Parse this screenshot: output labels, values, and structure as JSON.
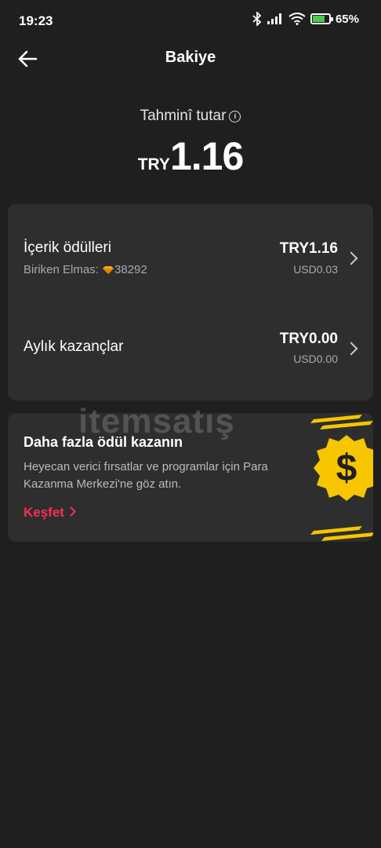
{
  "status": {
    "time": "19:23",
    "battery": "65%"
  },
  "header": {
    "title": "Bakiye"
  },
  "balance": {
    "label": "Tahminî tutar",
    "currency": "TRY",
    "value": "1.16"
  },
  "rows": [
    {
      "title": "İçerik ödülleri",
      "sub_label": "Biriken Elmas:",
      "sub_value": "38292",
      "amount": "TRY1.16",
      "usd": "USD0.03"
    },
    {
      "title": "Aylık kazançlar",
      "amount": "TRY0.00",
      "usd": "USD0.00"
    }
  ],
  "promo": {
    "title": "Daha fazla ödül kazanın",
    "desc": "Heyecan verici fırsatlar ve programlar için Para Kazanma Merkezi'ne göz atın.",
    "link": "Keşfet"
  },
  "watermark": "itemsatış",
  "colors": {
    "accent": "#fe2c55",
    "coin": "#f7c600",
    "background": "#1f1f1f",
    "card": "#2e2e2e"
  }
}
